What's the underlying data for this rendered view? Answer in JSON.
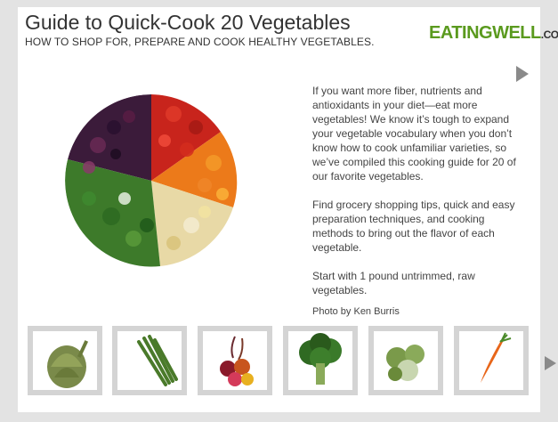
{
  "header": {
    "title": "Guide to Quick-Cook 20 Vegetables",
    "subtitle": "HOW TO SHOP FOR, PREPARE AND COOK HEALTHY VEGETABLES."
  },
  "logo": {
    "main": "EATINGWELL",
    "suffix": ".COM",
    "color": "#5a9a1e"
  },
  "navigation": {
    "next_icon": "triangle-right-icon",
    "thumbs_next_icon": "triangle-right-icon"
  },
  "content": {
    "paragraphs": [
      "If you want more fiber, nutrients and antioxidants in your diet—eat more vegetables! We know it’s tough to expand your vegetable vocabulary when you don’t know how to cook unfamiliar varieties, so we’ve compiled this cooking guide for 20 of our favorite vegetables.",
      "Find grocery shopping tips, quick and easy preparation techniques, and cooking methods to bring out the flavor of each vegetable.",
      "Start with 1 pound untrimmed, raw vegetables."
    ],
    "credit": "Photo by Ken Burris"
  },
  "thumbnails": [
    {
      "name": "artichoke"
    },
    {
      "name": "asparagus"
    },
    {
      "name": "beets"
    },
    {
      "name": "broccoli"
    },
    {
      "name": "brussels-sprouts"
    },
    {
      "name": "carrots"
    }
  ]
}
